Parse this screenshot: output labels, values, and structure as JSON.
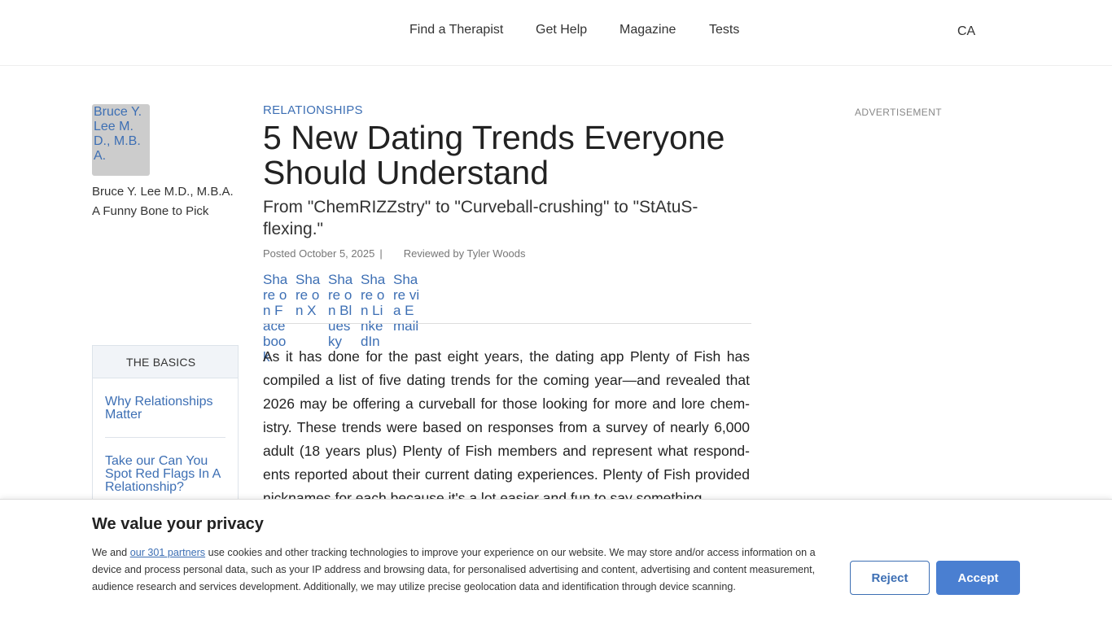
{
  "nav": {
    "items": [
      "Find a Therapist",
      "Get Help",
      "Magazine",
      "Tests"
    ],
    "region": "CA"
  },
  "author": {
    "photo_alt": "Bruce Y. Lee M.D., M.B.A.",
    "name": "Bruce Y. Lee M.D., M.B.A.",
    "blog": "A Funny Bone to Pick"
  },
  "basics": {
    "title": "THE BASICS",
    "links": [
      "Why Relationships Matter",
      "Take our Can You Spot Red Flags In A Relationship?"
    ]
  },
  "article": {
    "category": "RELATIONSHIPS",
    "title": "5 New Dating Trends Everyone Should Understand",
    "subtitle": "From \"ChemRIZZstry\" to \"Curveball-crushing\" to \"StAtuS-flexing.\"",
    "posted": "Posted October 5, 2025",
    "separator": "|",
    "reviewed": "Reviewed by Tyler Woods",
    "share_alts": [
      "Share on Facebook",
      "Share on X",
      "Share on Bluesky",
      "Share on LinkedIn",
      "Share via Email"
    ],
    "body": "As it has done for the past eight years, the dating app Plenty of Fish has compiled a list of five dating trends for the coming year—and revealed that 2026 may be offering a curveball for those looking for more and lore chem­istry. These trends were based on responses from a survey of nearly 6,000 adult (18 years plus) Plenty of Fish members and represent what respond­ents reported about their current dating experiences. Plenty of Fish provided nicknames for each because it's a lot easier and fun to say some­thing"
  },
  "sidebar": {
    "ad_label": "ADVERTISEMENT"
  },
  "cookie": {
    "title": "We value your privacy",
    "text_before": "We and ",
    "partners_link": "our 301 partners",
    "text_after": " use cookies and other tracking technologies to improve your experience on our website. We may store and/or access information on a device and process personal data, such as your IP address and browsing data, for personalised advertising and content, advertising and content measurement, audience research and services development. Additionally, we may utilize precise geolocation data and identification through device scanning.",
    "reject_label": "Reject",
    "accept_label": "Accept"
  }
}
